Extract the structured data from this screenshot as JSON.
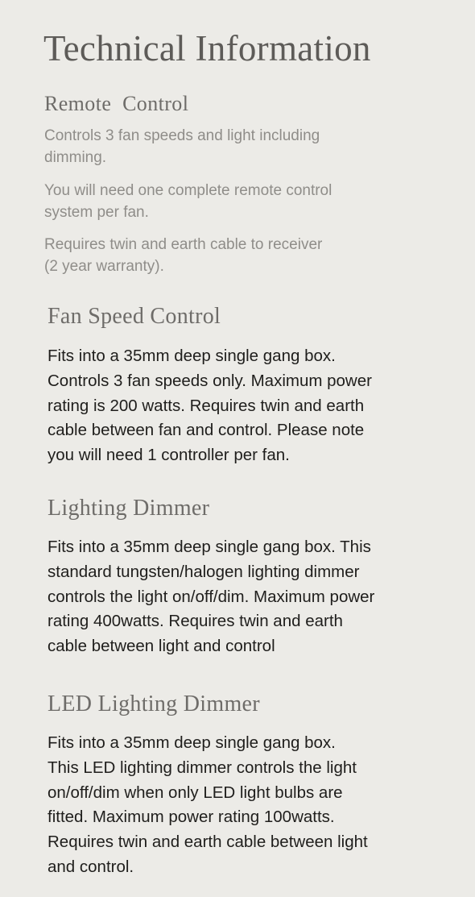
{
  "title": "Technical Information",
  "sections": [
    {
      "heading": "Remote  Control",
      "paragraphs": [
        [
          "Controls 3 fan speeds and light including",
          "dimming."
        ],
        [
          "You will need one complete remote control",
          "system per fan."
        ],
        [
          "Requires twin and earth cable to receiver",
          "(2 year warranty)."
        ]
      ]
    },
    {
      "heading": "Fan Speed Control",
      "lines": [
        "Fits into a 35mm deep single gang box.",
        "Controls 3 fan speeds only. Maximum power",
        "rating is 200 watts. Requires twin and earth",
        "cable between fan and control. Please note",
        "you will need 1 controller per fan."
      ]
    },
    {
      "heading": "Lighting Dimmer",
      "lines": [
        "Fits into a 35mm deep single gang box. This",
        "standard tungsten/halogen lighting dimmer",
        "controls the light on/off/dim. Maximum power",
        "rating 400watts. Requires twin and earth",
        "cable between light and control"
      ]
    },
    {
      "heading": "LED Lighting Dimmer",
      "lines": [
        "Fits into a 35mm deep single gang box.",
        "This LED lighting dimmer controls the light",
        "on/off/dim when only LED light bulbs are",
        "fitted. Maximum power rating 100watts.",
        "Requires twin and earth cable between light",
        "and control."
      ]
    }
  ]
}
